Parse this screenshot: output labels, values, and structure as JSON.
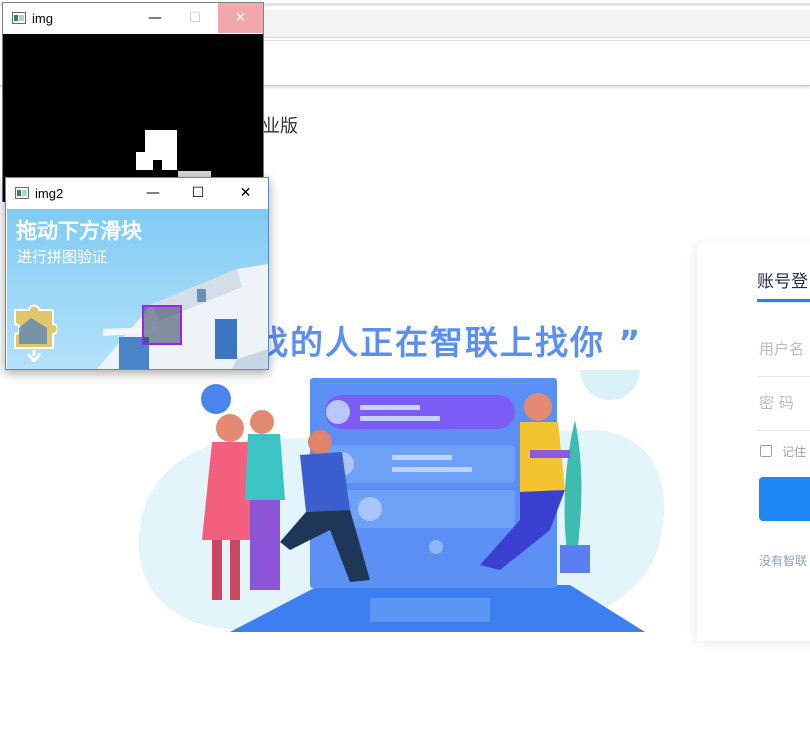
{
  "background_page": {
    "brand_fragment": "业版",
    "slogan": "找的人正在智联上找你 ”",
    "login": {
      "tab": "账号登",
      "username_placeholder": "用户名",
      "password_placeholder": "密 码",
      "remember_label": "记住",
      "register_text": "没有智联"
    }
  },
  "windows": {
    "img": {
      "title": "img",
      "controls": [
        "—",
        "☐",
        "✕"
      ]
    },
    "img2": {
      "title": "img2",
      "controls": [
        "—",
        "☐",
        "✕"
      ],
      "captcha_title": "拖动下方滑块",
      "captcha_subtitle": "进行拼图验证"
    }
  },
  "colors": {
    "accent_blue": "#1e88f7",
    "slogan_blue": "#5b8ff0",
    "close_hover_red": "#f1a7ac",
    "match_box_purple": "#a020f0"
  }
}
